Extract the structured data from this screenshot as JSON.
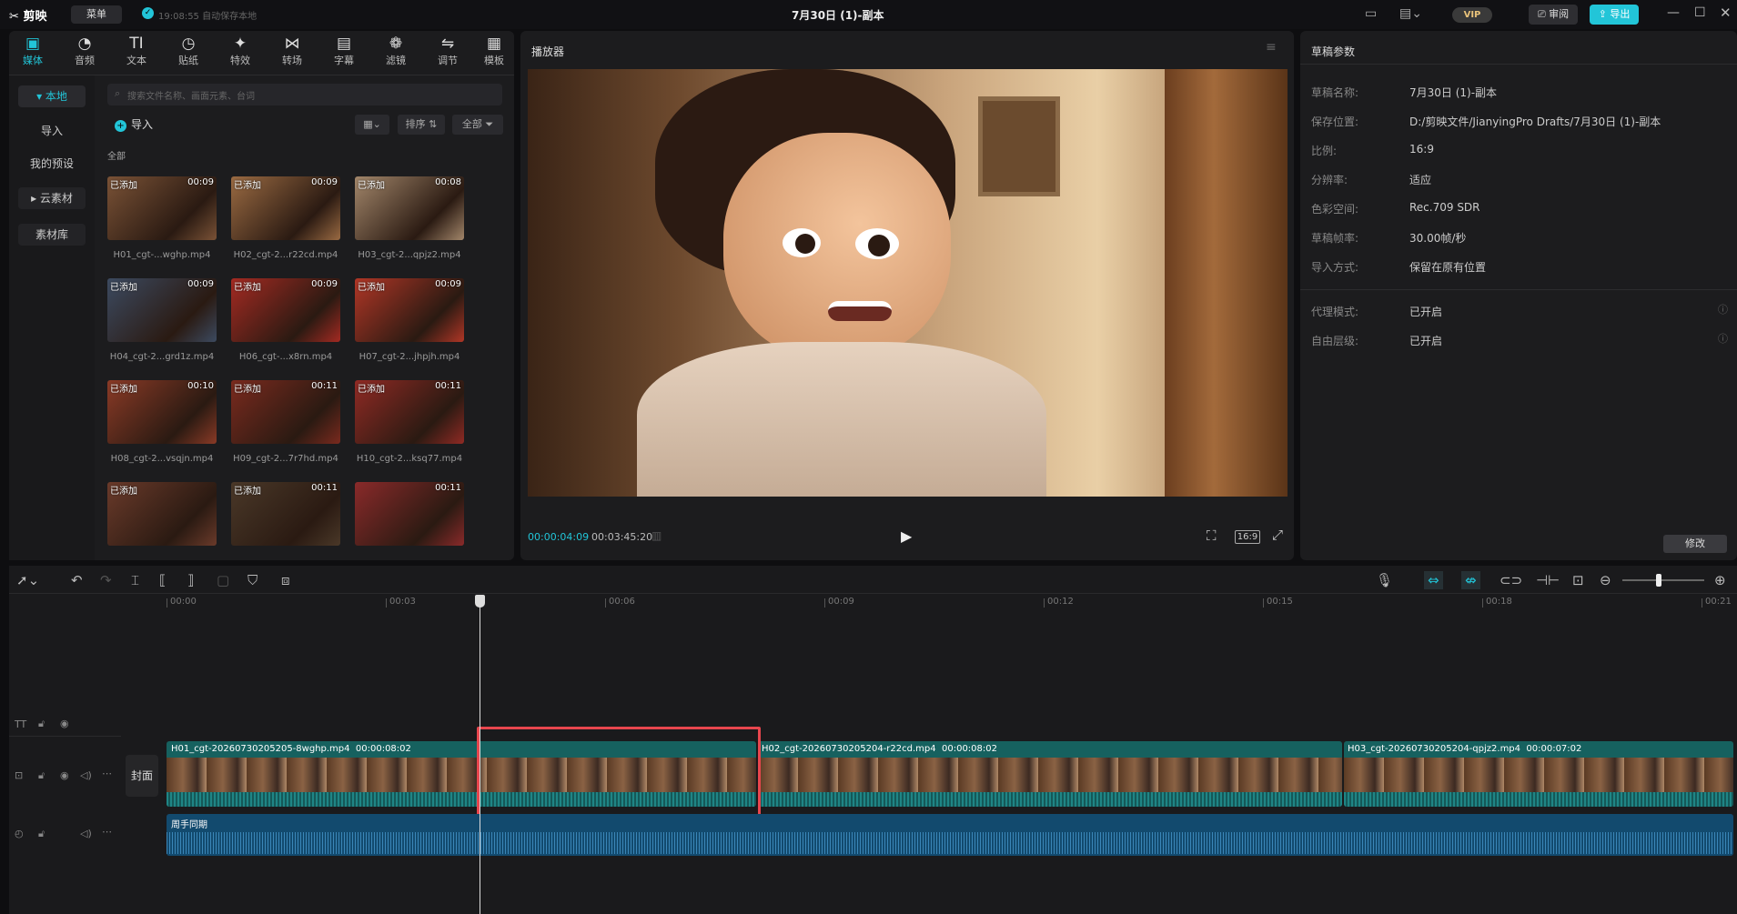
{
  "app": {
    "logo": "剪映",
    "menu_label": "菜单",
    "autosave": "19:08:55 自动保存本地",
    "title": "7月30日 (1)-副本",
    "vip": "VIP",
    "review_label": "审阅",
    "export_label": "导出"
  },
  "toolbar": [
    {
      "label": "媒体",
      "icon": "media-icon",
      "glyph": "▣"
    },
    {
      "label": "音频",
      "icon": "audio-icon",
      "glyph": "◔"
    },
    {
      "label": "文本",
      "icon": "text-icon",
      "glyph": "TI"
    },
    {
      "label": "贴纸",
      "icon": "sticker-icon",
      "glyph": "◷"
    },
    {
      "label": "特效",
      "icon": "effects-icon",
      "glyph": "✦"
    },
    {
      "label": "转场",
      "icon": "transition-icon",
      "glyph": "⋈"
    },
    {
      "label": "字幕",
      "icon": "subtitle-icon",
      "glyph": "▤"
    },
    {
      "label": "滤镜",
      "icon": "filter-icon",
      "glyph": "❁"
    },
    {
      "label": "调节",
      "icon": "adjust-icon",
      "glyph": "⇋"
    },
    {
      "label": "模板",
      "icon": "template-icon",
      "glyph": "▦"
    }
  ],
  "sidebar": [
    "本地",
    "导入",
    "我的预设",
    "云素材",
    "素材库"
  ],
  "media": {
    "search_placeholder": "搜索文件名称、画面元素、台词",
    "import_label": "导入",
    "sort_label": "排序",
    "filter_label": "全部",
    "section_label": "全部",
    "items": [
      {
        "tag": "已添加",
        "dur": "00:09",
        "name": "H01_cgt-...wghp.mp4"
      },
      {
        "tag": "已添加",
        "dur": "00:09",
        "name": "H02_cgt-2...r22cd.mp4"
      },
      {
        "tag": "已添加",
        "dur": "00:08",
        "name": "H03_cgt-2...qpjz2.mp4"
      },
      {
        "tag": "已添加",
        "dur": "00:09",
        "name": "H04_cgt-2...grd1z.mp4"
      },
      {
        "tag": "已添加",
        "dur": "00:09",
        "name": "H06_cgt-...x8rn.mp4"
      },
      {
        "tag": "已添加",
        "dur": "00:09",
        "name": "H07_cgt-2...jhpjh.mp4"
      },
      {
        "tag": "已添加",
        "dur": "00:10",
        "name": "H08_cgt-2...vsqjn.mp4"
      },
      {
        "tag": "已添加",
        "dur": "00:11",
        "name": "H09_cgt-2...7r7hd.mp4"
      },
      {
        "tag": "已添加",
        "dur": "00:11",
        "name": "H10_cgt-2...ksq77.mp4"
      },
      {
        "tag": "已添加",
        "dur": "",
        "name": ""
      },
      {
        "tag": "已添加",
        "dur": "00:11",
        "name": ""
      },
      {
        "tag": "",
        "dur": "00:11",
        "name": ""
      }
    ]
  },
  "player": {
    "title": "播放器",
    "current_time": "00:00:04:09",
    "total_time": "00:03:45:20",
    "ratio": "16:9"
  },
  "draft": {
    "title": "草稿参数",
    "rows": [
      {
        "label": "草稿名称:",
        "value": "7月30日 (1)-副本"
      },
      {
        "label": "保存位置:",
        "value": "D:/剪映文件/JianyingPro Drafts/7月30日 (1)-副本"
      },
      {
        "label": "比例:",
        "value": "16:9"
      },
      {
        "label": "分辨率:",
        "value": "适应"
      },
      {
        "label": "色彩空间:",
        "value": "Rec.709 SDR"
      },
      {
        "label": "草稿帧率:",
        "value": "30.00帧/秒"
      },
      {
        "label": "导入方式:",
        "value": "保留在原有位置"
      }
    ],
    "rows2": [
      {
        "label": "代理模式:",
        "value": "已开启"
      },
      {
        "label": "自由层级:",
        "value": "已开启"
      }
    ],
    "modify_label": "修改"
  },
  "timeline": {
    "ruler": [
      "00:00",
      "00:03",
      "00:06",
      "00:09",
      "00:12",
      "00:15",
      "00:18",
      "00:21"
    ],
    "cover_label": "封面",
    "clips": [
      {
        "name": "H01_cgt-20260730205205-8wghp.mp4",
        "dur": "00:00:08:02"
      },
      {
        "name": "H02_cgt-20260730205204-r22cd.mp4",
        "dur": "00:00:08:02"
      },
      {
        "name": "H03_cgt-20260730205204-qpjz2.mp4",
        "dur": "00:00:07:02"
      }
    ],
    "audio_label": "周手同期"
  }
}
